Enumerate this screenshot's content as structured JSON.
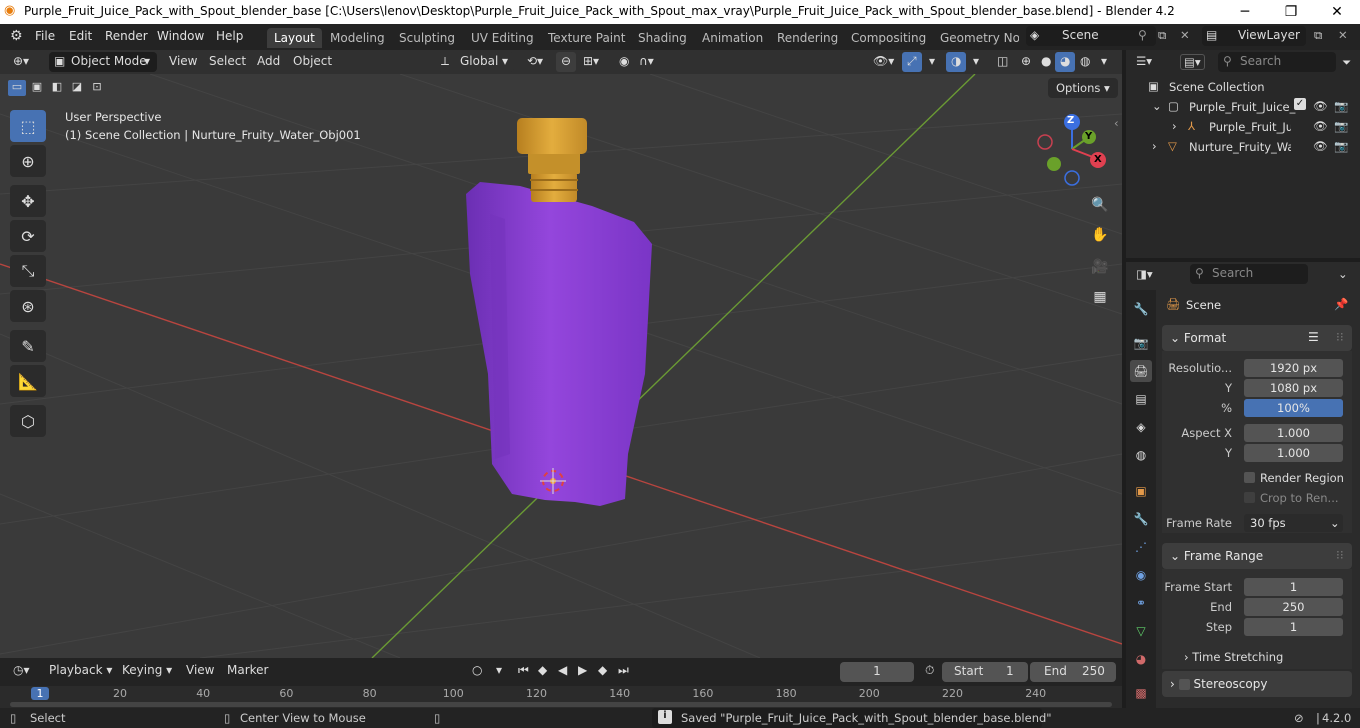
{
  "titlebar": {
    "title": "Purple_Fruit_Juice_Pack_with_Spout_blender_base [C:\\Users\\lenov\\Desktop\\Purple_Fruit_Juice_Pack_with_Spout_max_vray\\Purple_Fruit_Juice_Pack_with_Spout_blender_base.blend] - Blender 4.2",
    "minimize": "─",
    "maximize": "❐",
    "close": "✕"
  },
  "menubar": {
    "items": [
      "File",
      "Edit",
      "Render",
      "Window",
      "Help"
    ]
  },
  "workspaces": [
    "Layout",
    "Modeling",
    "Sculpting",
    "UV Editing",
    "Texture Paint",
    "Shading",
    "Animation",
    "Rendering",
    "Compositing",
    "Geometry Nod"
  ],
  "scene": {
    "label": "Scene",
    "viewlayer": "ViewLayer"
  },
  "viewport_header": {
    "mode": "Object Mode",
    "menus": [
      "View",
      "Select",
      "Add",
      "Object"
    ],
    "orientation": "Global",
    "options": "Options"
  },
  "viewport": {
    "perspective": "User Perspective",
    "collection_info": "(1) Scene Collection | Nurture_Fruity_Water_Obj001",
    "gizmo": {
      "z": "Z",
      "y": "Y",
      "x": "X"
    }
  },
  "outliner": {
    "search_placeholder": "Search",
    "rows": [
      {
        "label": "Scene Collection"
      },
      {
        "label": "Purple_Fruit_Juice_"
      },
      {
        "label": "Purple_Fruit_Ju"
      },
      {
        "label": "Nurture_Fruity_Wat"
      }
    ]
  },
  "properties": {
    "search_placeholder": "Search",
    "context": "Scene",
    "format": {
      "title": "Format",
      "resolution_label": "Resolutio...",
      "res_x": "1920 px",
      "y_label": "Y",
      "res_y": "1080 px",
      "pct_label": "%",
      "pct": "100%",
      "pct_fraction": 1.0,
      "aspect_label": "Aspect X",
      "aspect_x": "1.000",
      "aspect_y": "1.000",
      "render_region": "Render Region",
      "crop": "Crop to Ren...",
      "frame_rate_label": "Frame Rate",
      "frame_rate": "30 fps"
    },
    "frame_range": {
      "title": "Frame Range",
      "start_label": "Frame Start",
      "start": "1",
      "end_label": "End",
      "end": "250",
      "step_label": "Step",
      "step": "1",
      "time_stretching": "Time Stretching"
    },
    "stereoscopy": "Stereoscopy"
  },
  "timeline": {
    "menus": [
      "Playback",
      "Keying",
      "View",
      "Marker"
    ],
    "current_frame": "1",
    "start_label": "Start",
    "start": "1",
    "end_label": "End",
    "end": "250",
    "ticks": [
      "1",
      "20",
      "40",
      "60",
      "80",
      "100",
      "120",
      "140",
      "160",
      "180",
      "200",
      "220",
      "240"
    ]
  },
  "statusbar": {
    "select": "Select",
    "center": "Center View to Mouse",
    "message": "Saved \"Purple_Fruit_Juice_Pack_with_Spout_blender_base.blend\"",
    "version": "4.2.0"
  },
  "colors": {
    "accent": "#4772b3",
    "pack_purple": "#8a3fd6",
    "cap_gold": "#d9a030",
    "axis_x": "#c8453f",
    "axis_y": "#6ea33b"
  }
}
